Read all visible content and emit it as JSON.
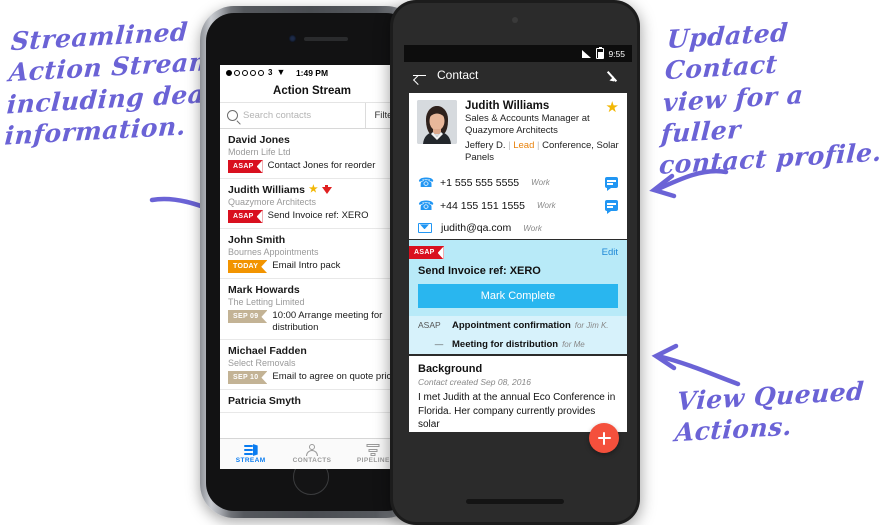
{
  "annotations": {
    "left": "Streamlined\nAction Stream\nincluding deal\ninformation.",
    "right_top": "Updated Contact\nview for a fuller\ncontact profile.",
    "right_bottom": "View Queued\nActions.",
    "ink_color": "#6b63d6"
  },
  "iphone": {
    "status": {
      "carrier": "3",
      "time": "1:49 PM",
      "wifi_icon": "wifi-icon",
      "battery_icon": "battery-icon"
    },
    "navbar": {
      "title": "Action Stream"
    },
    "search": {
      "placeholder": "Search contacts",
      "icon": "search-icon",
      "filter_label": "Filter"
    },
    "stream_items": [
      {
        "name": "David Jones",
        "company": "Modern Life Ltd",
        "badge": "ASAP",
        "badge_kind": "asap",
        "task": "Contact Jones for reorder",
        "star": false,
        "funnel": false
      },
      {
        "name": "Judith Williams",
        "company": "Quazymore Architects",
        "badge": "ASAP",
        "badge_kind": "asap",
        "task": "Send Invoice ref: XERO",
        "star": true,
        "funnel": true
      },
      {
        "name": "John Smith",
        "company": "Bournes Appointments",
        "badge": "TODAY",
        "badge_kind": "today",
        "task": "Email Intro pack",
        "star": false,
        "funnel": false
      },
      {
        "name": "Mark Howards",
        "company": "The Letting Limited",
        "badge": "SEP 09",
        "badge_kind": "date",
        "task": "10:00 Arrange meeting for distribution",
        "star": false,
        "funnel": false
      },
      {
        "name": "Michael Fadden",
        "company": "Select Removals",
        "badge": "SEP 10",
        "badge_kind": "date",
        "task": "Email to agree on quote price",
        "star": false,
        "funnel": false
      },
      {
        "name": "Patricia Smyth",
        "company": "",
        "badge": "",
        "badge_kind": "",
        "task": "",
        "star": false,
        "funnel": false
      }
    ],
    "tabs": [
      {
        "label": "STREAM",
        "icon": "stream-icon",
        "active": true
      },
      {
        "label": "CONTACTS",
        "icon": "person-icon",
        "active": false
      },
      {
        "label": "PIPELINE",
        "icon": "pipeline-icon",
        "active": false
      }
    ]
  },
  "android": {
    "status": {
      "time": "9:55",
      "signal_icon": "signal-icon",
      "battery_icon": "battery-icon"
    },
    "appbar": {
      "title": "Contact",
      "back_icon": "back-arrow-icon",
      "edit_icon": "pencil-icon"
    },
    "profile": {
      "name": "Judith Williams",
      "role": "Sales & Accounts Manager at Quazymore Architects",
      "owner": "Jeffery D.",
      "status_tag": "Lead",
      "source": "Conference, Solar Panels",
      "star_icon": "star-icon",
      "avatar": "contact-photo"
    },
    "contact_rows": [
      {
        "icon": "phone-icon",
        "value": "+1 555 555 5555",
        "type": "Work",
        "action_icon": "sms-icon"
      },
      {
        "icon": "phone-icon",
        "value": "+44 155 151 1555",
        "type": "Work",
        "action_icon": "sms-icon"
      },
      {
        "icon": "email-icon",
        "value": "judith@qa.com",
        "type": "Work",
        "action_icon": ""
      }
    ],
    "action_card": {
      "badge": "ASAP",
      "edit_label": "Edit",
      "title": "Send Invoice ref: XERO",
      "button_label": "Mark Complete",
      "accent": "#29b6ef",
      "background": "#b8eaf8"
    },
    "queued_actions": [
      {
        "when": "ASAP",
        "text": "Appointment confirmation",
        "for": "for Jim K."
      },
      {
        "when": "—",
        "text": "Meeting for distribution",
        "for": "for Me"
      }
    ],
    "background_section": {
      "title": "Background",
      "created": "Contact created Sep 08, 2016",
      "text": "I met Judith at the annual Eco Conference in Florida. Her company currently provides solar"
    },
    "fab": {
      "icon": "plus-icon",
      "color": "#f4503c"
    },
    "navigation": [
      {
        "icon": "nav-back-icon"
      },
      {
        "icon": "nav-home-icon"
      },
      {
        "icon": "nav-recents-icon"
      }
    ]
  }
}
